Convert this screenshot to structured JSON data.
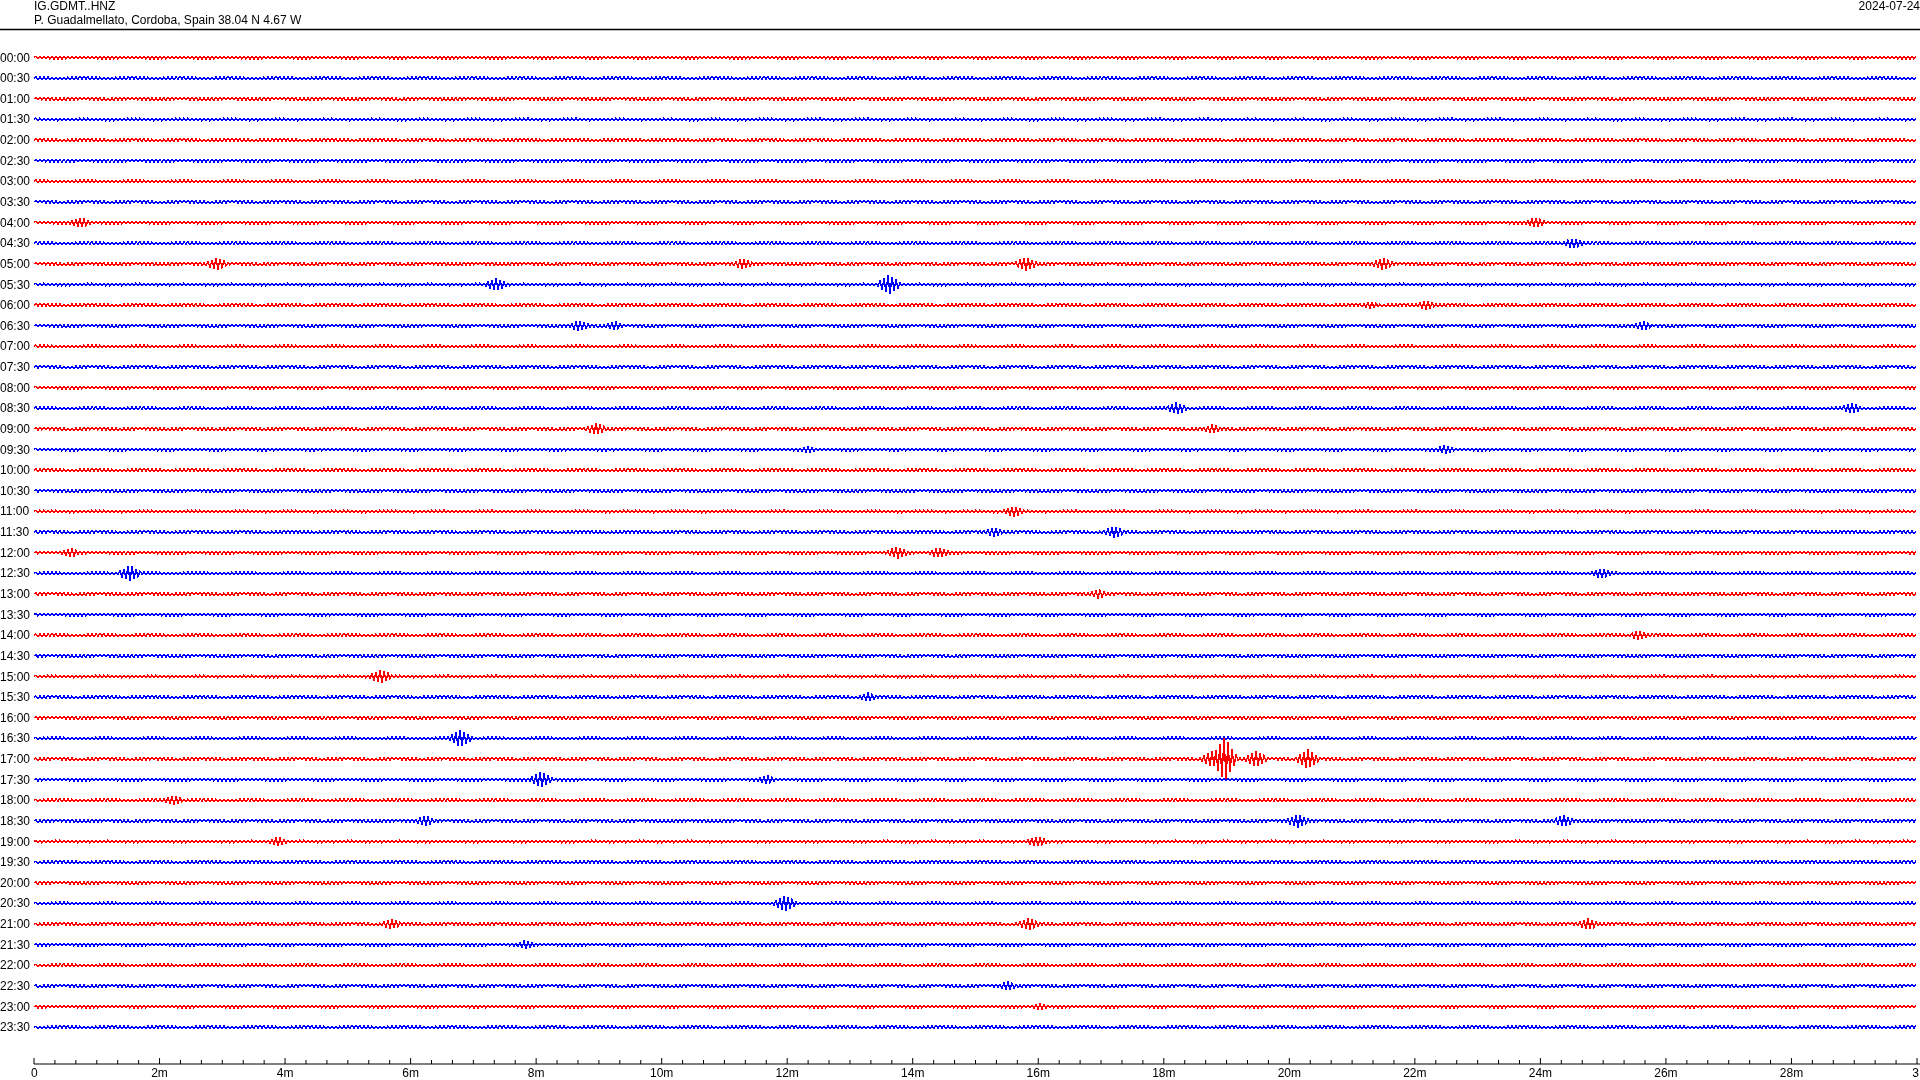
{
  "header": {
    "station": "IG.GDMT..HNZ",
    "location": "P. Guadalmellato, Cordoba, Spain  38.04 N 4.67 W",
    "date": "2024-07-24"
  },
  "rows": [
    {
      "label": "00:00",
      "color": "#ff0000"
    },
    {
      "label": "00:30",
      "color": "#0000ff"
    },
    {
      "label": "01:00",
      "color": "#ff0000"
    },
    {
      "label": "01:30",
      "color": "#0000ff"
    },
    {
      "label": "02:00",
      "color": "#ff0000"
    },
    {
      "label": "02:30",
      "color": "#0000ff"
    },
    {
      "label": "03:00",
      "color": "#ff0000"
    },
    {
      "label": "03:30",
      "color": "#0000ff"
    },
    {
      "label": "04:00",
      "color": "#ff0000"
    },
    {
      "label": "04:30",
      "color": "#0000ff"
    },
    {
      "label": "05:00",
      "color": "#ff0000"
    },
    {
      "label": "05:30",
      "color": "#0000ff"
    },
    {
      "label": "06:00",
      "color": "#ff0000"
    },
    {
      "label": "06:30",
      "color": "#0000ff"
    },
    {
      "label": "07:00",
      "color": "#ff0000"
    },
    {
      "label": "07:30",
      "color": "#0000ff"
    },
    {
      "label": "08:00",
      "color": "#ff0000"
    },
    {
      "label": "08:30",
      "color": "#0000ff"
    },
    {
      "label": "09:00",
      "color": "#ff0000"
    },
    {
      "label": "09:30",
      "color": "#0000ff"
    },
    {
      "label": "10:00",
      "color": "#ff0000"
    },
    {
      "label": "10:30",
      "color": "#0000ff"
    },
    {
      "label": "11:00",
      "color": "#ff0000"
    },
    {
      "label": "11:30",
      "color": "#0000ff"
    },
    {
      "label": "12:00",
      "color": "#ff0000"
    },
    {
      "label": "12:30",
      "color": "#0000ff"
    },
    {
      "label": "13:00",
      "color": "#ff0000"
    },
    {
      "label": "13:30",
      "color": "#0000ff"
    },
    {
      "label": "14:00",
      "color": "#ff0000"
    },
    {
      "label": "14:30",
      "color": "#0000ff"
    },
    {
      "label": "15:00",
      "color": "#ff0000"
    },
    {
      "label": "15:30",
      "color": "#0000ff"
    },
    {
      "label": "16:00",
      "color": "#ff0000"
    },
    {
      "label": "16:30",
      "color": "#0000ff"
    },
    {
      "label": "17:00",
      "color": "#ff0000"
    },
    {
      "label": "17:30",
      "color": "#0000ff"
    },
    {
      "label": "18:00",
      "color": "#ff0000"
    },
    {
      "label": "18:30",
      "color": "#0000ff"
    },
    {
      "label": "19:00",
      "color": "#ff0000"
    },
    {
      "label": "19:30",
      "color": "#0000ff"
    },
    {
      "label": "20:00",
      "color": "#ff0000"
    },
    {
      "label": "20:30",
      "color": "#0000ff"
    },
    {
      "label": "21:00",
      "color": "#ff0000"
    },
    {
      "label": "21:30",
      "color": "#0000ff"
    },
    {
      "label": "22:00",
      "color": "#ff0000"
    },
    {
      "label": "22:30",
      "color": "#0000ff"
    },
    {
      "label": "23:00",
      "color": "#ff0000"
    },
    {
      "label": "23:30",
      "color": "#0000ff"
    }
  ],
  "time_axis": {
    "ticks": [
      "0",
      "2m",
      "4m",
      "6m",
      "8m",
      "10m",
      "12m",
      "14m",
      "16m",
      "18m",
      "20m",
      "22m",
      "24m",
      "26m",
      "28m",
      "3"
    ]
  }
}
